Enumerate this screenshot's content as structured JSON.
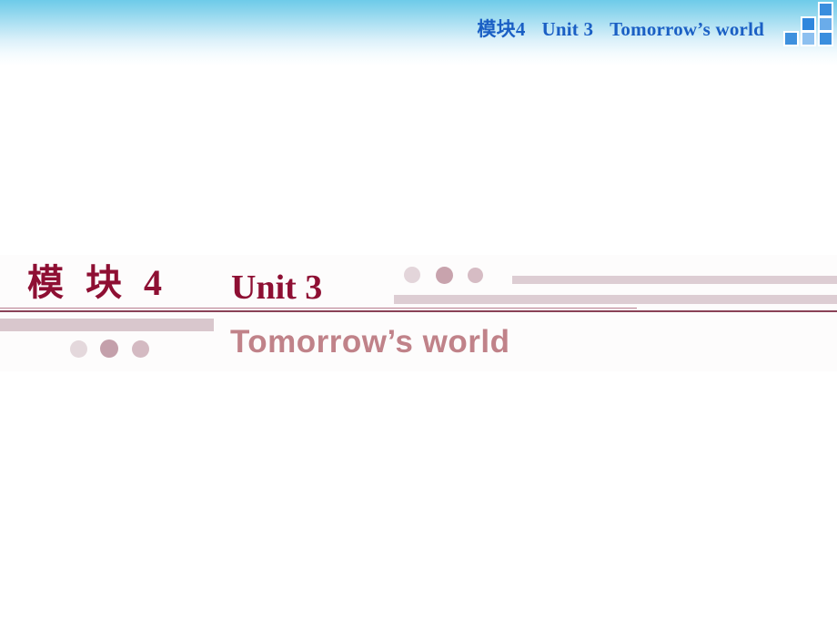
{
  "header": {
    "title_module": "模块4",
    "title_unit": "Unit 3",
    "title_topic": "Tomorrow’s world",
    "accent_color": "#1a5fc4",
    "band_color_top": "#6ecbe9",
    "band_color_bottom": "#ffffff",
    "squares": [
      {
        "name": "square-top-right",
        "color": "#3a8ede"
      },
      {
        "name": "square-mid-left",
        "color": "#2f86dd"
      },
      {
        "name": "square-mid-right",
        "color": "#6aacea"
      },
      {
        "name": "square-bottom-left",
        "color": "#3e90de"
      },
      {
        "name": "square-bottom-center",
        "color": "#8dc0f0"
      },
      {
        "name": "square-bottom-right",
        "color": "#3a8ede"
      }
    ]
  },
  "main": {
    "module_title": "模 块 4",
    "unit_title": "Unit 3",
    "subtitle": "Tomorrow’s world",
    "title_color": "#8e0f33",
    "subtitle_color": "#c08289",
    "rule_color": "#8a4257",
    "bar_color": "#ddcdd3",
    "dots": [
      {
        "name": "dot-upper-1",
        "color": "#e3d5da"
      },
      {
        "name": "dot-upper-2",
        "color": "#c8a3ad"
      },
      {
        "name": "dot-upper-3",
        "color": "#d6bcc4"
      },
      {
        "name": "dot-lower-1",
        "color": "#e4d8dc"
      },
      {
        "name": "dot-lower-2",
        "color": "#c4a0ab"
      },
      {
        "name": "dot-lower-3",
        "color": "#d4bac2"
      }
    ]
  }
}
